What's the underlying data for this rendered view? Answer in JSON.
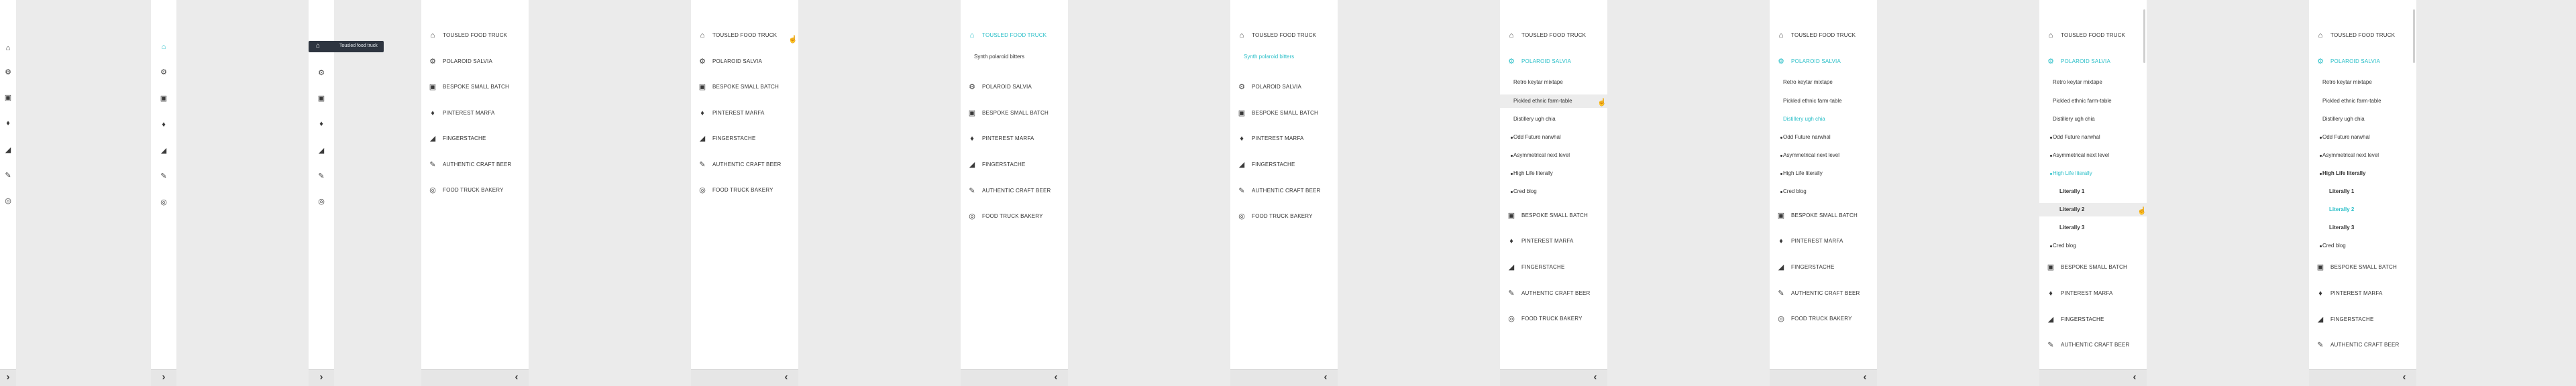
{
  "nav_labels": {
    "toulses": "Tousled food truck",
    "polaroid": "Polaroid salvia",
    "bespoke": "Bespoke small batch",
    "pinterest": "Pinterest marfa",
    "fingerstache": "Fingerstache",
    "craft": "Authentic craft beer",
    "bakery": "Food truck bakery"
  },
  "sub_labels": {
    "synth": "Synth polaroid bitters",
    "retro": "Retro keytar mixtape",
    "pickled": "Pickled ethnic farm-table",
    "distillery": "Distillery ugh chia",
    "odd": "Odd Future narwhal",
    "asym": "Asymmetrical next level",
    "highlife": "High Life literally",
    "cred": "Cred blog",
    "lit1": "Literally 1",
    "lit2": "Literally 2",
    "lit3": "Literally 3"
  },
  "tooltip_text": "Tousled food truck",
  "icons": {
    "home": "⌂",
    "settings": "⚙",
    "briefcase": "▣",
    "drop": "♦",
    "chart": "◢",
    "pencil": "✎",
    "lifering": "◎"
  },
  "chevrons": {
    "expand": "›",
    "collapse": "‹"
  },
  "colors": {
    "accent": "#2abfc8"
  }
}
